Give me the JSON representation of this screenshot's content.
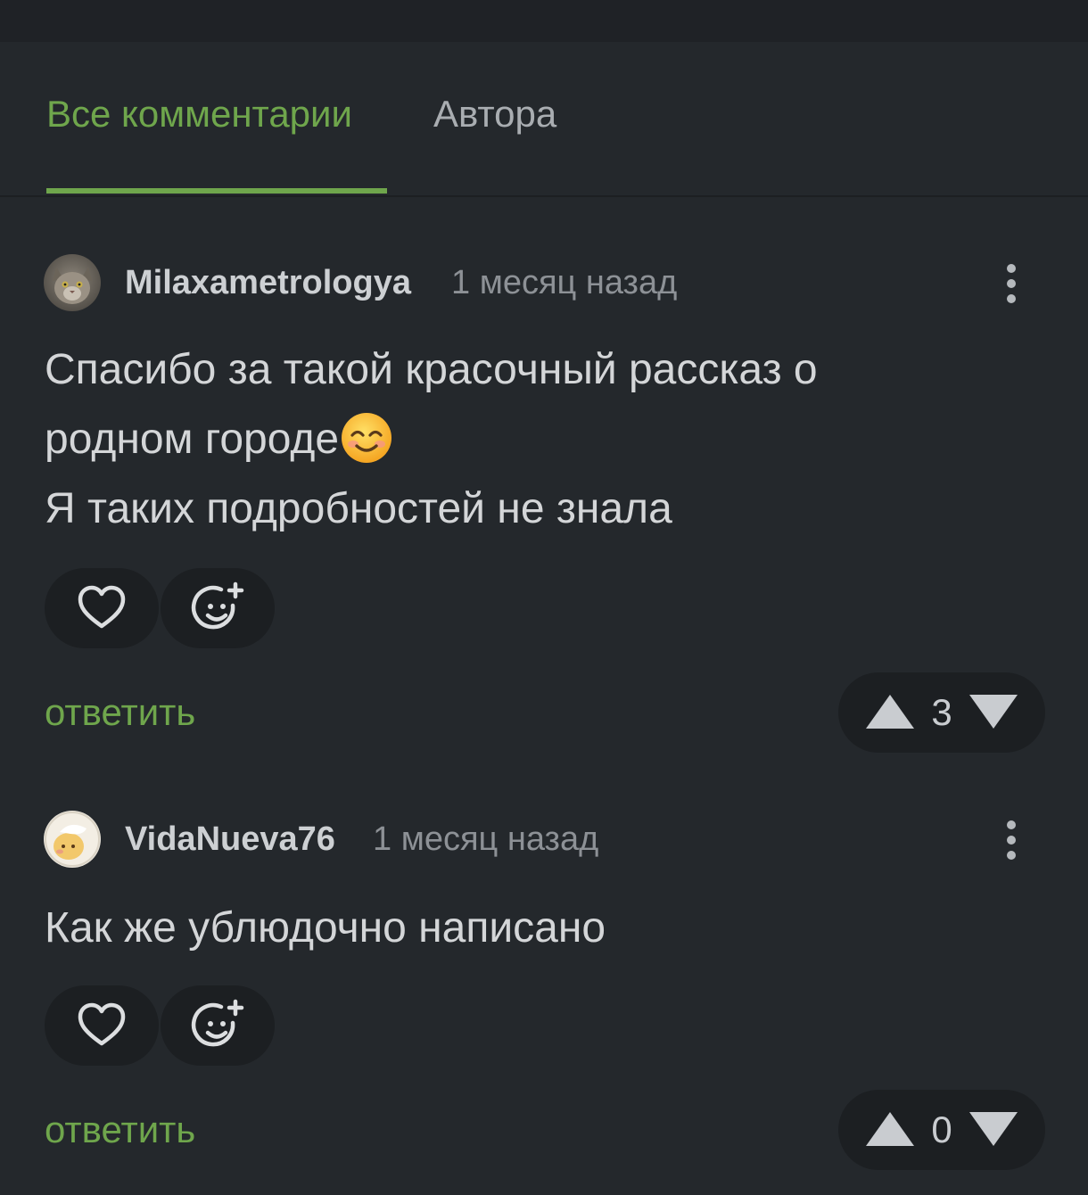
{
  "tabs": {
    "all_label": "Все комментарии",
    "author_label": "Автора"
  },
  "comments": [
    {
      "author": "Milaxametrologya",
      "time": "1 месяц назад",
      "text_lines": [
        "Спасибо за такой красочный рассказ о",
        "родном городе",
        "Я таких подробностей не знала"
      ],
      "emoji": "smiling-face-emoji",
      "reply_label": "ответить",
      "votes": "3"
    },
    {
      "author": "VidaNueva76",
      "time": "1 месяц назад",
      "text_lines": [
        "Как же ублюдочно написано"
      ],
      "reply_label": "ответить",
      "votes": "0"
    }
  ],
  "colors": {
    "accent": "#6fa64c",
    "background": "#24282c",
    "button_bg": "#1c1f22"
  }
}
